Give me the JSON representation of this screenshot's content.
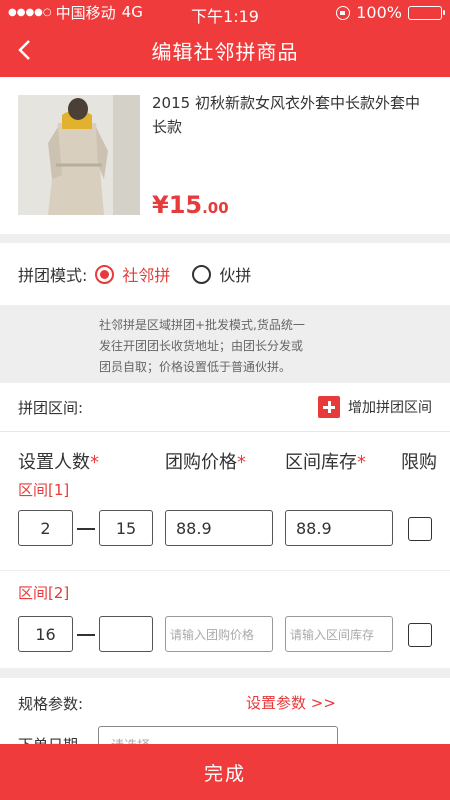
{
  "status_bar": {
    "signal_dots": "●●●●○",
    "carrier": "中国移动",
    "network": "4G",
    "time": "下午1:19",
    "battery": "100%"
  },
  "nav": {
    "title": "编辑社邻拼商品",
    "back_icon": "chevron-left-icon"
  },
  "product": {
    "name": "2015 初秋新款女风衣外套中长款外套中长款",
    "price_symbol": "¥",
    "price_int": "15",
    "price_dec": ".00"
  },
  "group_mode": {
    "label": "拼团模式:",
    "options": [
      {
        "label": "社邻拼",
        "checked": true
      },
      {
        "label": "伙拼",
        "checked": false
      }
    ],
    "description": [
      "社邻拼是区域拼团+批发模式,货品统一",
      "发往开团团长收货地址；由团长分发或",
      "团员自取；价格设置低于普通伙拼。"
    ]
  },
  "range_section": {
    "label": "拼团区间:",
    "add_label": "增加拼团区间"
  },
  "table": {
    "headers": {
      "people": "设置人数",
      "price": "团购价格",
      "stock": "区间库存",
      "limit": "限购",
      "required_mark": "*"
    },
    "ranges": [
      {
        "label": "区间[1]",
        "from": "2",
        "to": "15",
        "price": "88.9",
        "stock": "88.9",
        "limit_checked": false
      },
      {
        "label": "区间[2]",
        "from": "16",
        "to": "",
        "price": "",
        "stock": "",
        "limit_checked": false
      }
    ],
    "price_placeholder": "请输入团购价格",
    "stock_placeholder": "请输入区间库存"
  },
  "spec": {
    "label": "规格参数:",
    "link": "设置参数 >>",
    "row2_label": "下单日期",
    "row2_placeholder": "请选择"
  },
  "footer": {
    "done": "完成"
  },
  "colors": {
    "brand": "#ef3b3b",
    "accent_text": "#e73a3a"
  }
}
